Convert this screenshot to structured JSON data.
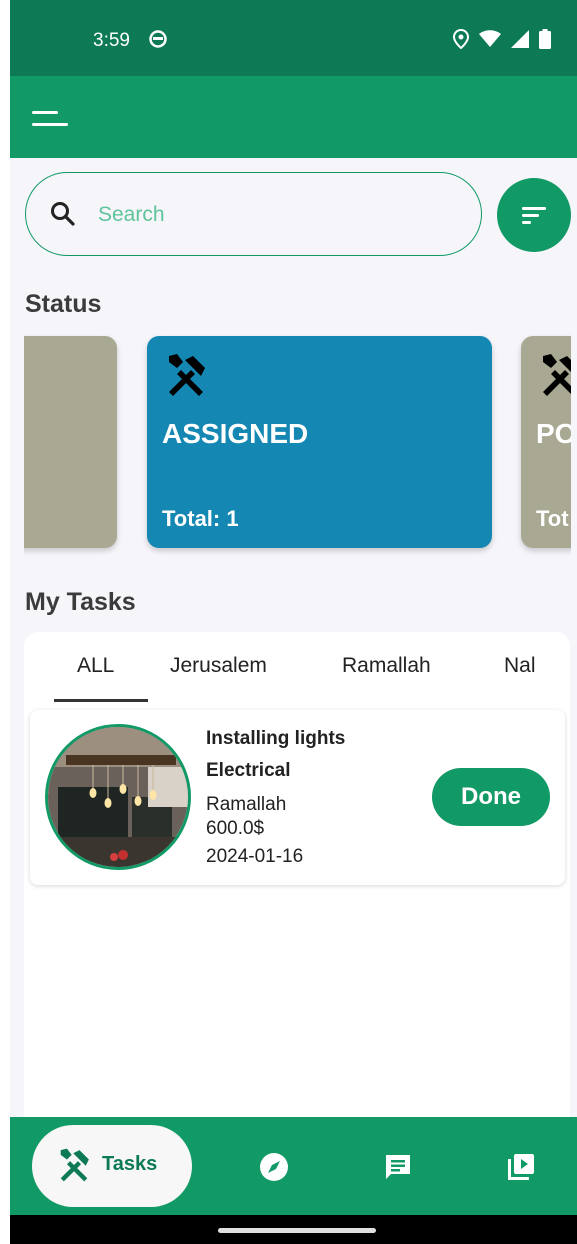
{
  "status_bar": {
    "time": "3:59"
  },
  "search": {
    "placeholder": "Search",
    "value": ""
  },
  "sections": {
    "status": "Status",
    "my_tasks": "My Tasks"
  },
  "status_cards": [
    {
      "title": "",
      "total": "",
      "color": "#a8a893"
    },
    {
      "title": "ASSIGNED",
      "total": "Total: 1",
      "color": "#1487b3"
    },
    {
      "title": "PO",
      "total": "Tot",
      "color": "#a8a893"
    }
  ],
  "tabs": [
    {
      "label": "ALL",
      "selected": true
    },
    {
      "label": "Jerusalem",
      "selected": false
    },
    {
      "label": "Ramallah",
      "selected": false
    },
    {
      "label": "Nal",
      "selected": false
    }
  ],
  "task": {
    "name": "Installing lights",
    "category": "Electrical",
    "city": "Ramallah",
    "price": "600.0$",
    "date": "2024-01-16",
    "action": "Done"
  },
  "bottom_nav": {
    "tasks_label": "Tasks",
    "items": [
      "tools-icon",
      "compass-icon",
      "message-icon",
      "video-library-icon"
    ]
  },
  "colors": {
    "primary": "#119966",
    "status_bar": "#0e7a55",
    "card_blue": "#1487b3",
    "card_gray": "#a8a893"
  }
}
